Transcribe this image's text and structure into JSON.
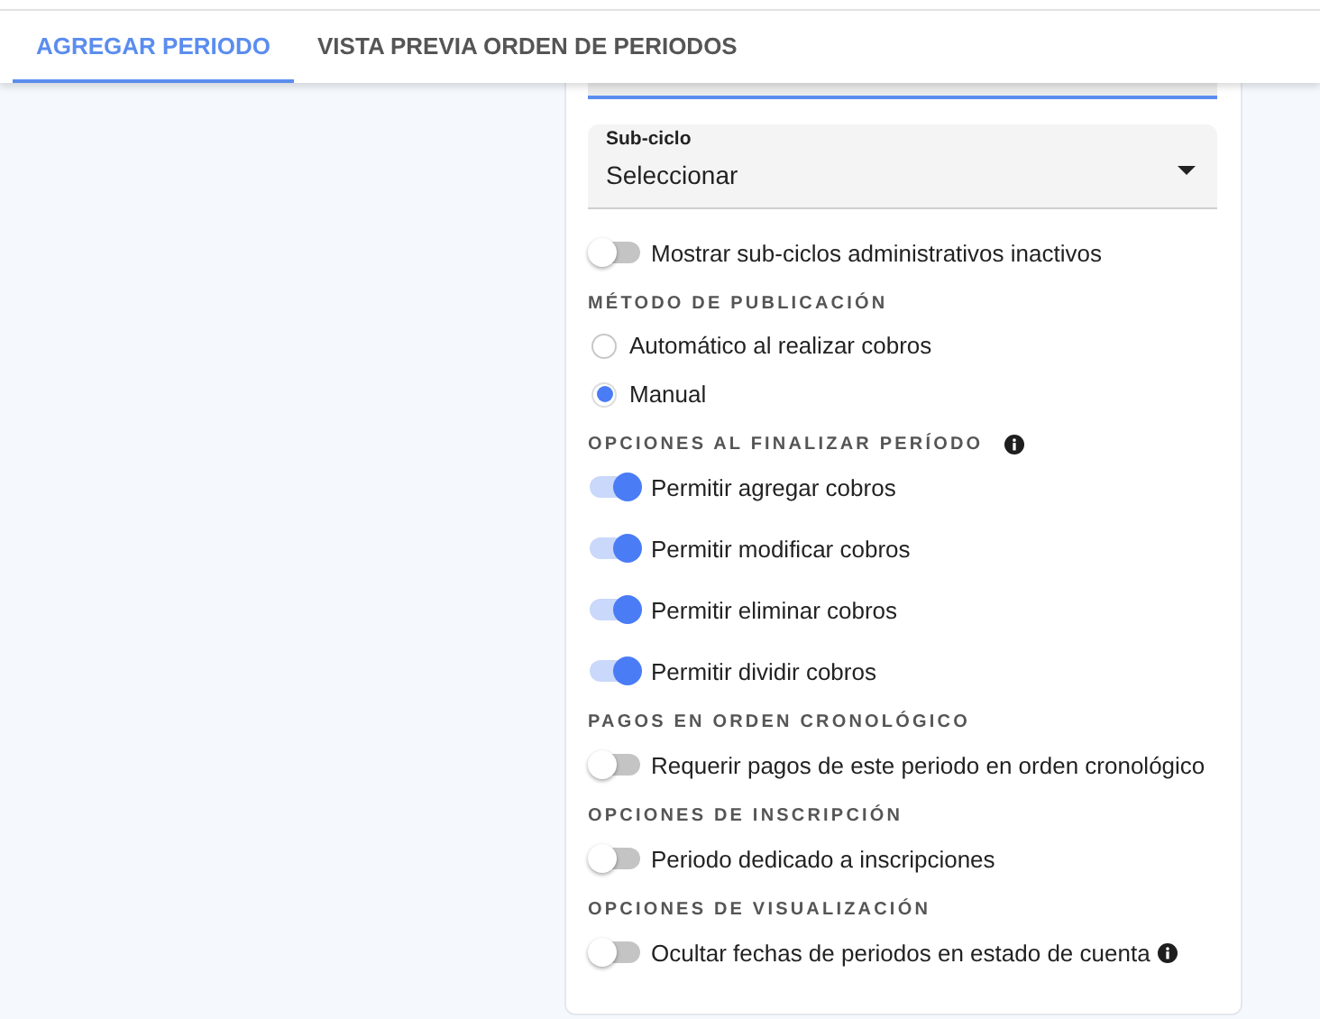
{
  "tabs": [
    {
      "label": "AGREGAR PERIODO",
      "selected": true
    },
    {
      "label": "VISTA PREVIA ORDEN DE PERIODOS",
      "selected": false
    }
  ],
  "subcycle_select": {
    "label": "Sub-ciclo",
    "value": "Seleccionar"
  },
  "items": [
    {
      "kind": "toggle",
      "label": "Mostrar sub-ciclos administrativos inactivos",
      "on": false
    },
    {
      "kind": "heading",
      "label": "MÉTODO DE PUBLICACIÓN"
    },
    {
      "kind": "radio",
      "label": "Automático al realizar cobros",
      "selected": false
    },
    {
      "kind": "radio",
      "label": "Manual",
      "selected": true
    },
    {
      "kind": "heading",
      "label": "OPCIONES AL FINALIZAR PERÍODO",
      "info": true
    },
    {
      "kind": "toggle",
      "label": "Permitir agregar cobros",
      "on": true
    },
    {
      "kind": "toggle",
      "label": "Permitir modificar cobros",
      "on": true
    },
    {
      "kind": "toggle",
      "label": "Permitir eliminar cobros",
      "on": true
    },
    {
      "kind": "toggle",
      "label": "Permitir dividir cobros",
      "on": true
    },
    {
      "kind": "heading",
      "label": "PAGOS EN ORDEN CRONOLÓGICO"
    },
    {
      "kind": "toggle",
      "label": "Requerir pagos de este periodo en orden cronológico",
      "on": false
    },
    {
      "kind": "heading",
      "label": "OPCIONES DE INSCRIPCIÓN"
    },
    {
      "kind": "toggle",
      "label": "Periodo dedicado a inscripciones",
      "on": false
    },
    {
      "kind": "heading",
      "label": "OPCIONES DE VISUALIZACIÓN"
    },
    {
      "kind": "toggle",
      "label": "Ocultar fechas de periodos en estado de cuenta",
      "on": false,
      "info": true
    }
  ]
}
